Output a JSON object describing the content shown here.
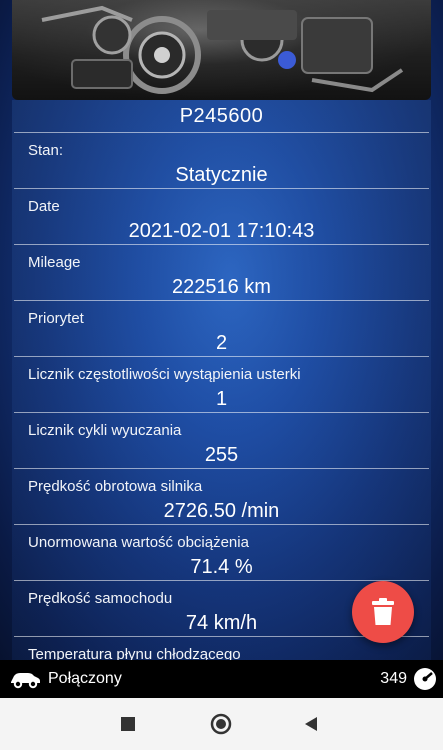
{
  "header": {
    "image": "engine-photo"
  },
  "dtc": {
    "code": "P245600",
    "rows": [
      {
        "label": "Stan:",
        "value": "Statycznie"
      },
      {
        "label": "Date",
        "value": "2021-02-01 17:10:43"
      },
      {
        "label": "Mileage",
        "value": "222516 km"
      },
      {
        "label": "Priorytet",
        "value": "2"
      },
      {
        "label": "Licznik częstotliwości wystąpienia usterki",
        "value": "1"
      },
      {
        "label": "Licznik cykli wyuczania",
        "value": "255"
      },
      {
        "label": "Prędkość obrotowa silnika",
        "value": "2726.50 /min"
      },
      {
        "label": "Unormowana wartość obciążenia",
        "value": "71.4 %"
      },
      {
        "label": "Prędkość samochodu",
        "value": "74 km/h"
      },
      {
        "label": "Temperatura płynu chłodzącego",
        "value": ""
      }
    ]
  },
  "fab": {
    "icon": "trash-icon",
    "color": "#ee4c47"
  },
  "status": {
    "connection": "Połączony",
    "count": "349",
    "car_icon": "car-icon",
    "gauge_icon": "gauge-icon"
  },
  "nav": {
    "recents_icon": "square-icon",
    "home_icon": "circle-icon",
    "back_icon": "triangle-back-icon"
  }
}
